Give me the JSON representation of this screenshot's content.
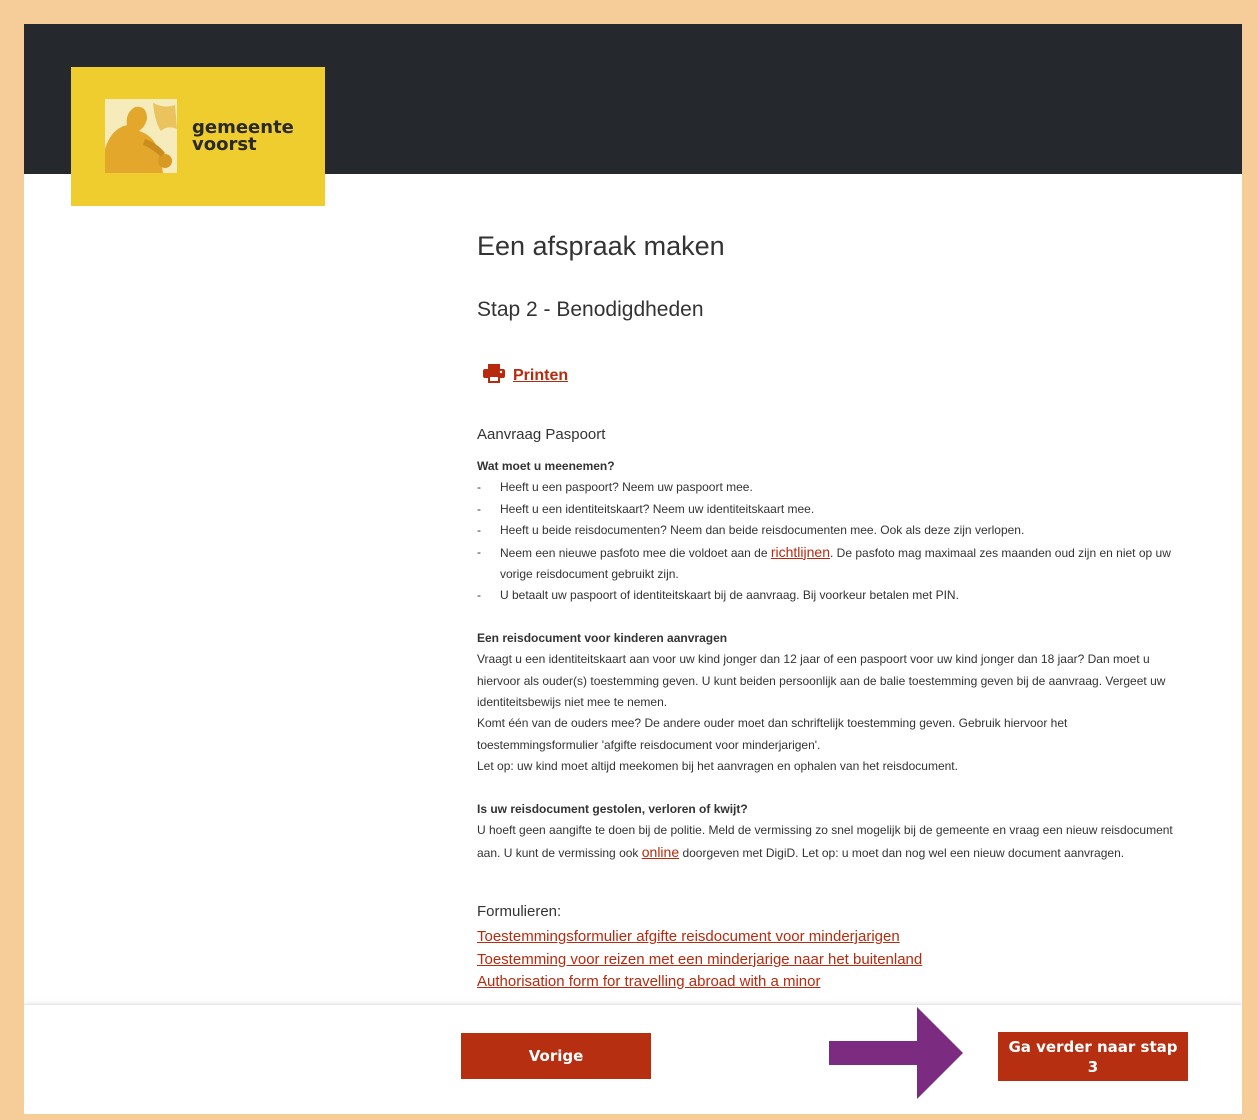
{
  "header": {
    "logo_line1": "gemeente",
    "logo_line2": "voorst",
    "logo_color": "#f0cd2e",
    "bar_color": "#25292d"
  },
  "page": {
    "title": "Een afspraak maken",
    "step": "Stap 2 - Benodigdheden",
    "print_label": "Printen",
    "print_icon": "printer-icon",
    "document_title": "Aanvraag Paspoort"
  },
  "sections": {
    "bring": {
      "heading": "Wat moet u meenemen?",
      "items": [
        "Heeft u een paspoort? Neem uw paspoort mee.",
        "Heeft u een identiteitskaart? Neem uw identiteitskaart mee.",
        "Heeft u beide reisdocumenten? Neem dan beide reisdocumenten mee. Ook als deze zijn verlopen."
      ],
      "item4_pre": "Neem een nieuwe pasfoto mee die voldoet aan de ",
      "item4_link": "richtlijnen",
      "item4_post": ". De pasfoto mag maximaal zes maanden oud zijn en niet op uw vorige reisdocument gebruikt zijn.",
      "item5": "U betaalt uw paspoort of identiteitskaart bij de aanvraag. Bij voorkeur betalen met PIN."
    },
    "children": {
      "heading": "Een reisdocument voor kinderen aanvragen",
      "p1": "Vraagt u een identiteitskaart aan voor uw kind jonger dan 12 jaar of een paspoort voor uw kind jonger dan 18 jaar? Dan moet u hiervoor als ouder(s) toestemming geven. U kunt beiden persoonlijk aan de balie toestemming geven bij de aanvraag. Vergeet uw identiteitsbewijs niet mee te nemen.",
      "p2": "Komt één van de ouders mee? De andere ouder moet dan schriftelijk toestemming geven. Gebruik hiervoor het toestemmingsformulier 'afgifte reisdocument voor minderjarigen'.",
      "p3": "Let op: uw kind moet altijd meekomen bij het aanvragen en ophalen van het reisdocument."
    },
    "stolen": {
      "heading": "Is uw reisdocument gestolen, verloren of kwijt?",
      "pre": "U hoeft geen aangifte te doen bij de politie. Meld de vermissing zo snel mogelijk bij de gemeente en vraag een nieuw reisdocument aan. U kunt de vermissing ook ",
      "link": "online",
      "post": " doorgeven met DigiD. Let op: u moet dan nog wel een nieuw document aanvragen."
    }
  },
  "forms": {
    "label": "Formulieren:",
    "links": [
      "Toestemmingsformulier afgifte reisdocument voor minderjarigen",
      "Toestemming voor reizen met een minderjarige naar het buitenland",
      "Authorisation form for travelling abroad with a minor"
    ]
  },
  "footer": {
    "prev_label": "Vorige",
    "next_label": "Ga verder naar stap 3",
    "button_color": "#b52f10",
    "arrow_color": "#7b2c80"
  }
}
